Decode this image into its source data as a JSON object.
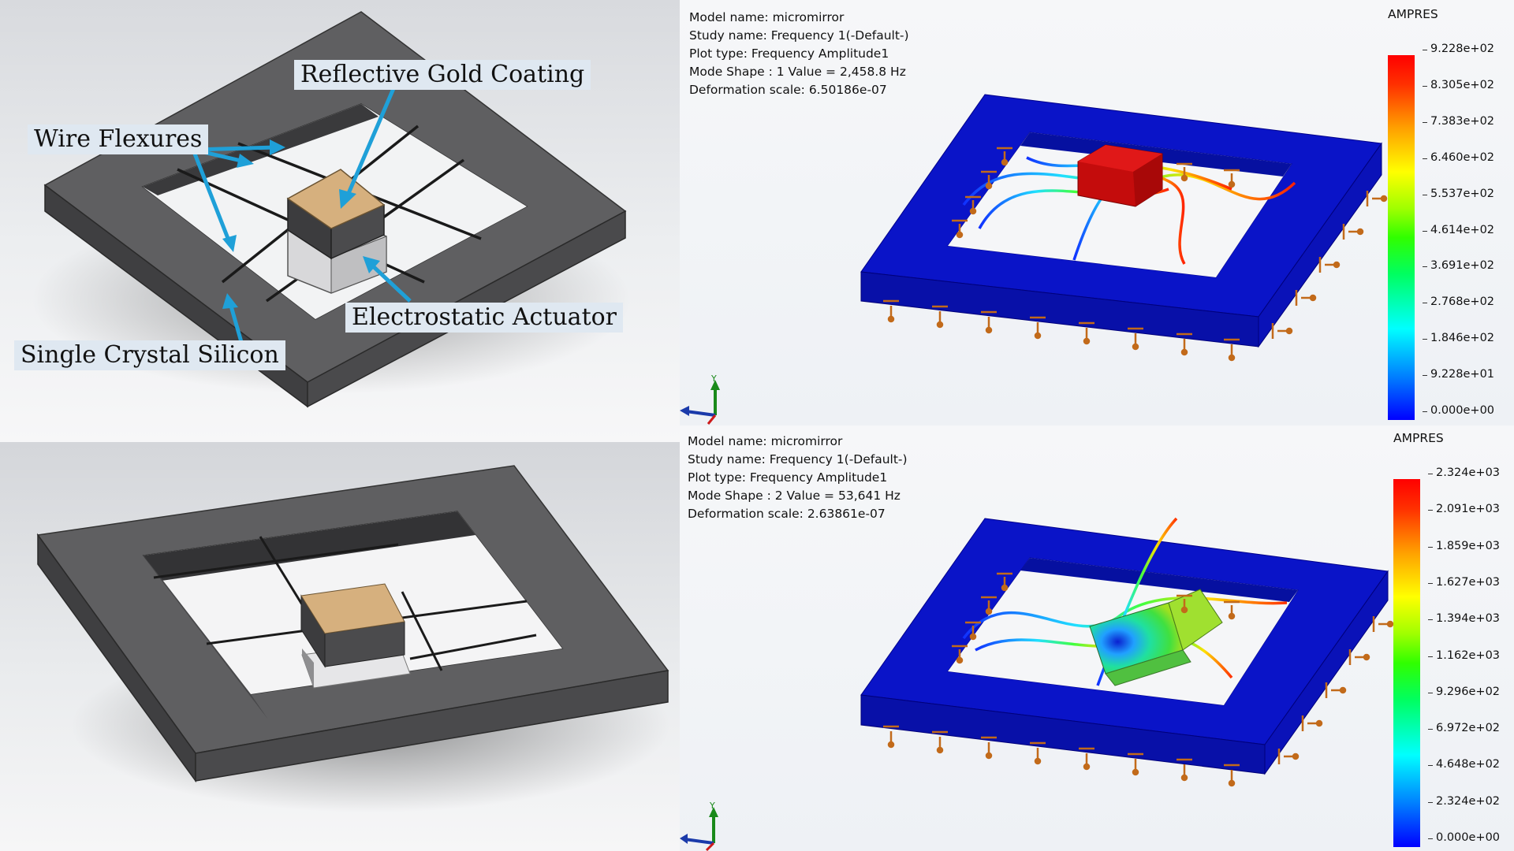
{
  "callouts": {
    "reflective_gold_coating": "Reflective Gold Coating",
    "wire_flexures": "Wire Flexures",
    "electrostatic_actuator": "Electrostatic Actuator",
    "single_crystal_silicon": "Single Crystal Silicon"
  },
  "study_top": {
    "model_name": "Model name: micromirror",
    "study_name": "Study name: Frequency 1(-Default-)",
    "plot_type": "Plot type: Frequency Amplitude1",
    "mode_shape": "Mode Shape : 1   Value =        2,458.8 Hz",
    "deformation_scale": "Deformation scale: 6.50186e-07",
    "legend_title": "AMPRES",
    "ticks": [
      "9.228e+02",
      "8.305e+02",
      "7.383e+02",
      "6.460e+02",
      "5.537e+02",
      "4.614e+02",
      "3.691e+02",
      "2.768e+02",
      "1.846e+02",
      "9.228e+01",
      "0.000e+00"
    ],
    "axis_label": "Y"
  },
  "study_bottom": {
    "model_name": "Model name: micromirror",
    "study_name": "Study name: Frequency 1(-Default-)",
    "plot_type": "Plot type: Frequency Amplitude1",
    "mode_shape": "Mode Shape : 2   Value =        53,641 Hz",
    "deformation_scale": "Deformation scale: 2.63861e-07",
    "legend_title": "AMPRES",
    "ticks": [
      "2.324e+03",
      "2.091e+03",
      "1.859e+03",
      "1.627e+03",
      "1.394e+03",
      "1.162e+03",
      "9.296e+02",
      "6.972e+02",
      "4.648e+02",
      "2.324e+02",
      "0.000e+00"
    ],
    "axis_label": "Y"
  },
  "colors": {
    "silicon_frame": "#5b5b5d",
    "gold_coating": "#d6b07e",
    "callout_arrow": "#1fa0d8",
    "callout_bg": "#dfe8f1",
    "fea_frame": "#0a14c8",
    "mode1_mirror": "#d81010",
    "fixture": "#c26a1a"
  },
  "icons": [
    "fixture-arrow-icon",
    "triad-axis-icon"
  ]
}
